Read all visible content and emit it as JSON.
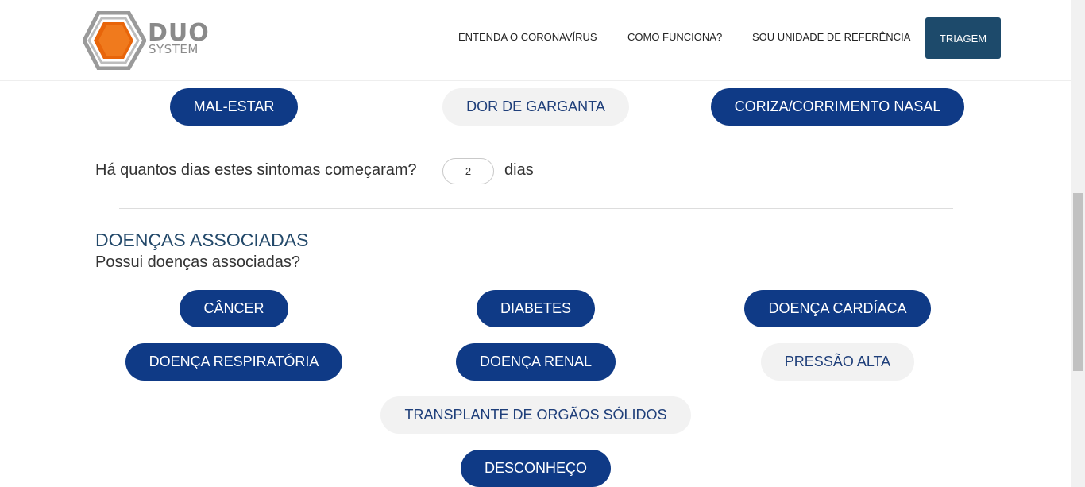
{
  "logo": {
    "primary": "DUO",
    "secondary": "SYSTEM",
    "accent_color": "#e8650a"
  },
  "nav": {
    "links": [
      "ENTENDA O CORONAVÍRUS",
      "COMO FUNCIONA?",
      "SOU UNIDADE DE REFERÊNCIA"
    ],
    "cta": "TRIAGEM",
    "cta_color": "#1d4a6b"
  },
  "symptoms": {
    "options": [
      {
        "label": "MAL-ESTAR",
        "selected": true
      },
      {
        "label": "DOR DE GARGANTA",
        "selected": false
      },
      {
        "label": "CORIZA/CORRIMENTO NASAL",
        "selected": true
      }
    ],
    "days_question": "Há quantos dias estes sintomas começaram?",
    "days_value": "2",
    "days_suffix": "dias"
  },
  "conditions": {
    "title": "DOENÇAS ASSOCIADAS",
    "question": "Possui doenças associadas?",
    "options": [
      {
        "label": "CÂNCER",
        "selected": true
      },
      {
        "label": "DIABETES",
        "selected": true
      },
      {
        "label": "DOENÇA CARDÍACA",
        "selected": true
      },
      {
        "label": "DOENÇA RESPIRATÓRIA",
        "selected": true
      },
      {
        "label": "DOENÇA RENAL",
        "selected": true
      },
      {
        "label": "PRESSÃO ALTA",
        "selected": false
      },
      {
        "label": "TRANSPLANTE DE ORGÃOS SÓLIDOS",
        "selected": false
      },
      {
        "label": "DESCONHEÇO",
        "selected": true
      }
    ]
  },
  "colors": {
    "selected_pill": "#0f3a86",
    "unselected_pill": "#f2f2f2",
    "section_title": "#23496a"
  }
}
